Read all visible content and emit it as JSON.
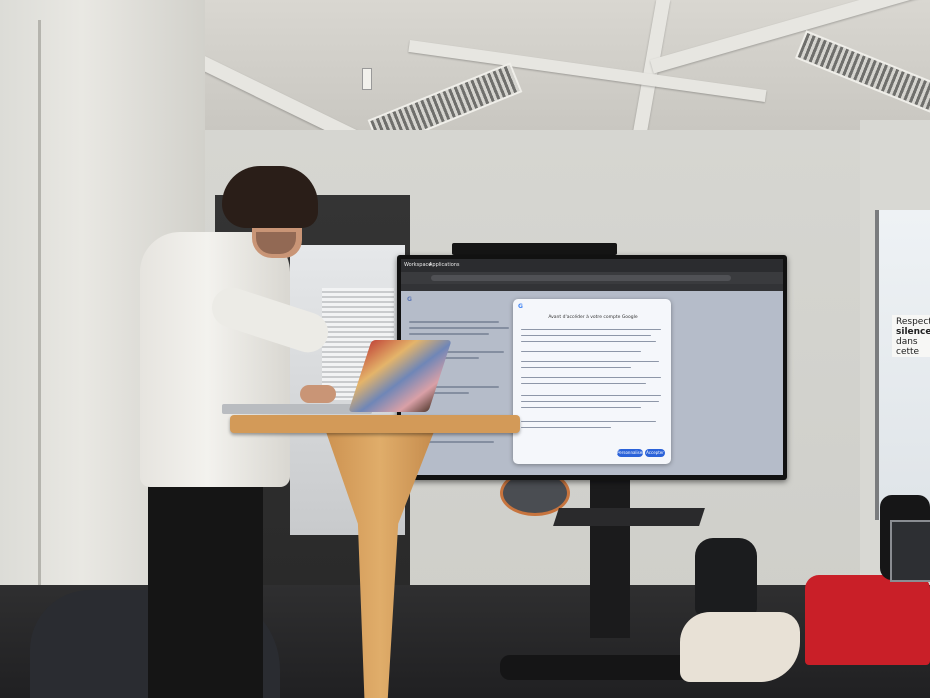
{
  "scene": {
    "screen": {
      "tab_left": "Workspace",
      "tab_title": "Applications",
      "dialog": {
        "logo": "G",
        "title": "Avant d'accéder à votre compte Google",
        "btn_personalize": "Personnaliser",
        "btn_accept": "Accepter"
      }
    },
    "signage": {
      "line1": "Respect",
      "line2": "silence",
      "line3": "dans cette"
    }
  }
}
